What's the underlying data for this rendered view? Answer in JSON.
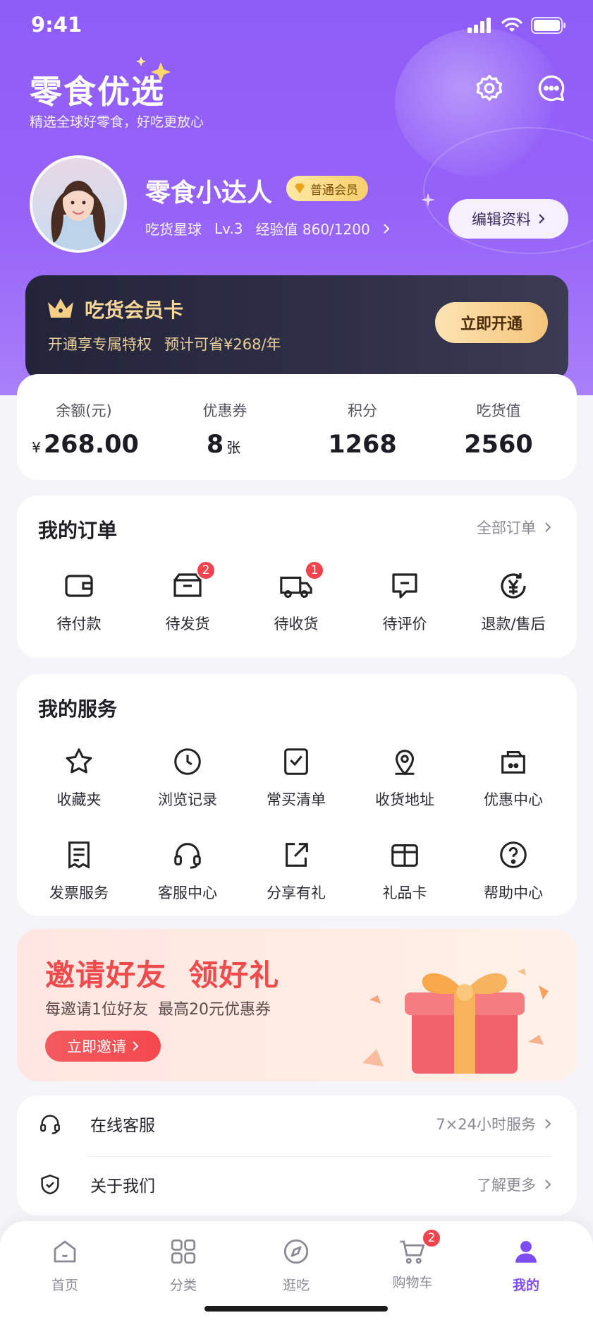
{
  "status_bar": {
    "time": "9:41"
  },
  "header": {
    "title": "零食优选",
    "subtitle": "精选全球好零食，好吃更放心",
    "icons": [
      "gear-icon",
      "message-icon"
    ]
  },
  "profile": {
    "name": "零食小达人",
    "member_badge": "普通会员",
    "planet": "吃货星球",
    "level": "Lv.3",
    "exp": "经验值 860/1200",
    "edit_label": "编辑资料"
  },
  "vip": {
    "title": "吃货会员卡",
    "desc1": "开通享专属特权",
    "desc2": "预计可省¥268/年",
    "button": "立即开通"
  },
  "assets": [
    {
      "label": "余额(元)",
      "prefix": "¥",
      "value": "268.00",
      "unit": ""
    },
    {
      "label": "优惠券",
      "prefix": "",
      "value": "8",
      "unit": "张"
    },
    {
      "label": "积分",
      "prefix": "",
      "value": "1268",
      "unit": ""
    },
    {
      "label": "吃货值",
      "prefix": "",
      "value": "2560",
      "unit": ""
    }
  ],
  "orders": {
    "title": "我的订单",
    "more": "全部订单",
    "items": [
      {
        "label": "待付款",
        "icon": "wallet-icon",
        "badge": ""
      },
      {
        "label": "待发货",
        "icon": "box-icon",
        "badge": "2"
      },
      {
        "label": "待收货",
        "icon": "truck-icon",
        "badge": "1"
      },
      {
        "label": "待评价",
        "icon": "comment-icon",
        "badge": ""
      },
      {
        "label": "退款/售后",
        "icon": "refund-icon",
        "badge": ""
      }
    ]
  },
  "services": {
    "title": "我的服务",
    "items": [
      {
        "label": "收藏夹",
        "icon": "star-icon"
      },
      {
        "label": "浏览记录",
        "icon": "clock-icon"
      },
      {
        "label": "常买清单",
        "icon": "checklist-icon"
      },
      {
        "label": "收货地址",
        "icon": "location-icon"
      },
      {
        "label": "优惠中心",
        "icon": "coupon-icon"
      },
      {
        "label": "发票服务",
        "icon": "invoice-icon"
      },
      {
        "label": "客服中心",
        "icon": "headset-icon"
      },
      {
        "label": "分享有礼",
        "icon": "share-icon"
      },
      {
        "label": "礼品卡",
        "icon": "gift-card-icon"
      },
      {
        "label": "帮助中心",
        "icon": "help-icon"
      }
    ]
  },
  "invite": {
    "title": "邀请好友  领好礼",
    "subtitle": "每邀请1位好友  最高20元优惠券",
    "button": "立即邀请"
  },
  "list": [
    {
      "label": "在线客服",
      "right": "7×24小时服务",
      "icon": "headset-icon"
    },
    {
      "label": "关于我们",
      "right": "了解更多",
      "icon": "shield-icon"
    }
  ],
  "tabbar": {
    "items": [
      {
        "label": "首页",
        "icon": "home-icon",
        "badge": ""
      },
      {
        "label": "分类",
        "icon": "grid-icon",
        "badge": ""
      },
      {
        "label": "逛吃",
        "icon": "compass-icon",
        "badge": ""
      },
      {
        "label": "购物车",
        "icon": "cart-icon",
        "badge": "2"
      },
      {
        "label": "我的",
        "icon": "user-icon",
        "badge": ""
      }
    ],
    "active": "我的"
  },
  "colors": {
    "accent": "#8e5cf7",
    "badge": "#f3434e",
    "gold": "#f4c57b",
    "invite_red": "#ef4b4d"
  }
}
